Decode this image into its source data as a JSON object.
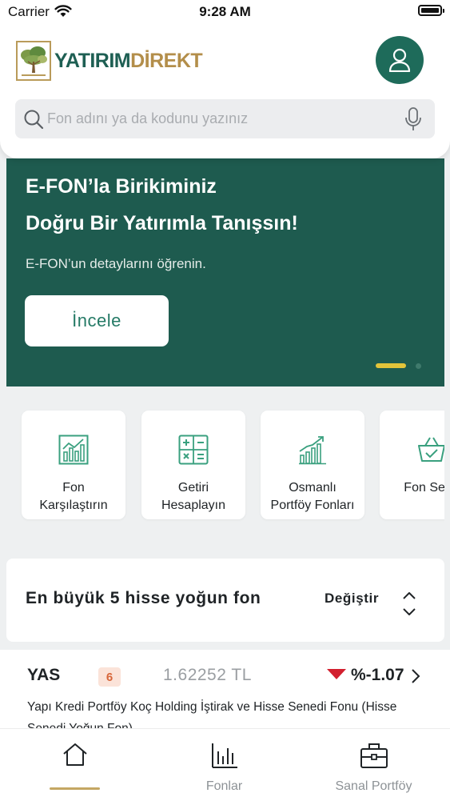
{
  "status_bar": {
    "carrier": "Carrier",
    "time": "9:28 AM"
  },
  "header": {
    "logo": {
      "part1": "YATIRIM",
      "part2": "DİREKT"
    },
    "search": {
      "placeholder": "Fon adını ya da kodunu yazınız"
    }
  },
  "banner": {
    "title_line1": "E-FON’la Birikiminiz",
    "title_line2": "Doğru Bir Yatırımla Tanışsın!",
    "subtitle": "E-FON’un detaylarını öğrenin.",
    "button_label": "İncele",
    "page_indicator": {
      "count": 2,
      "active": 0
    }
  },
  "quick_actions": [
    {
      "line1": "Fon",
      "line2": "Karşılaştırın",
      "icon": "compare-chart-icon"
    },
    {
      "line1": "Getiri",
      "line2": "Hesaplayın",
      "icon": "calculator-icon"
    },
    {
      "line1": "Osmanlı",
      "line2": "Portföy Fonları",
      "icon": "growth-chart-icon"
    },
    {
      "line1": "Fon Sepe",
      "line2": "",
      "icon": "basket-icon"
    }
  ],
  "top_funds": {
    "title": "En büyük 5 hisse yoğun fon",
    "change_label": "Değiştir"
  },
  "fund": {
    "code": "YAS",
    "risk": "6",
    "price": "1.62252 TL",
    "change": "%-1.07",
    "trend": "down",
    "name": "Yapı Kredi Portföy Koç Holding İştirak ve Hisse Senedi Fonu (Hisse Senedi Yoğun Fon)"
  },
  "tab_bar": {
    "active": "home",
    "tabs": [
      {
        "id": "home",
        "label": ""
      },
      {
        "id": "funds",
        "label": "Fonlar"
      },
      {
        "id": "virtual-portfolio",
        "label": "Sanal Portföy"
      }
    ]
  },
  "colors": {
    "brand_green": "#1e5b4f",
    "accent_gold": "#c4a763",
    "icon_green": "#3aa07f",
    "risk_badge_bg": "#fbe3d9",
    "risk_badge_text": "#d7663a",
    "down_red": "#d21f2e"
  }
}
